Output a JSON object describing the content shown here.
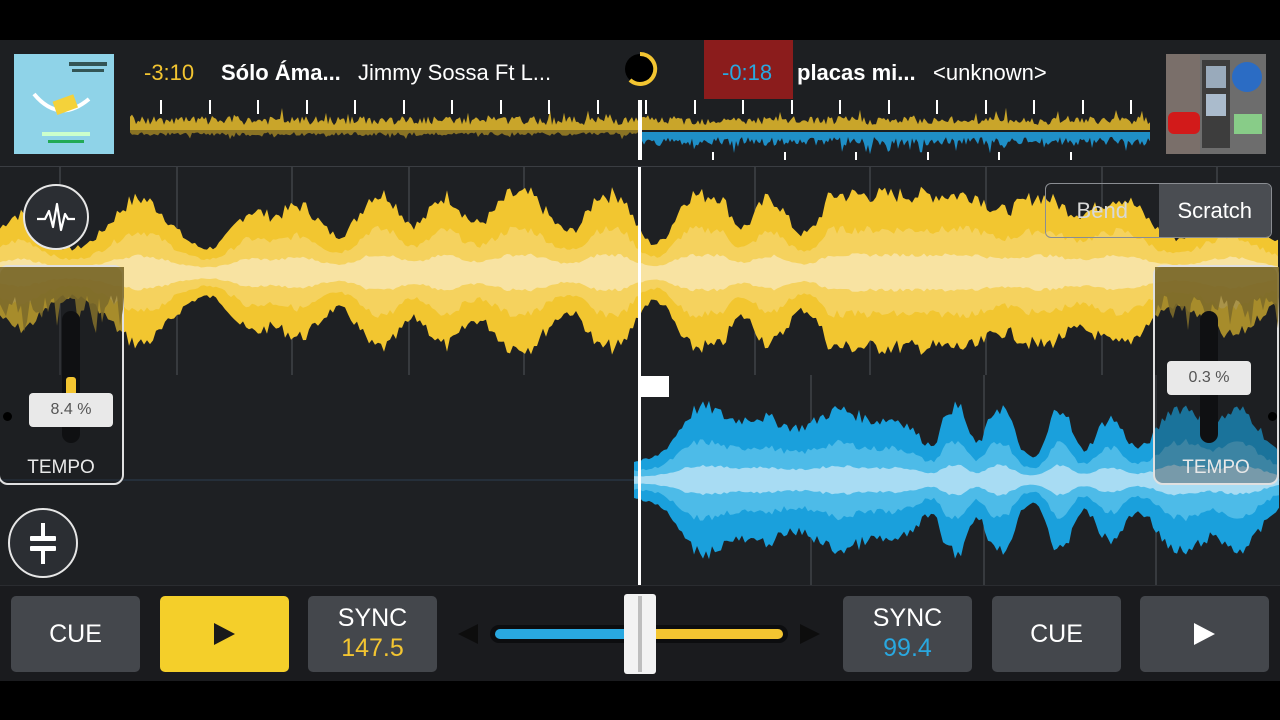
{
  "deckA": {
    "remaining_time": "-3:10",
    "title": "Sólo Áma...",
    "artist": "Jimmy Sossa Ft L...",
    "tempo_value": "8.4 %",
    "tempo_label": "TEMPO",
    "cue_label": "CUE",
    "sync_label": "SYNC",
    "bpm": "147.5",
    "color": "#f3c531"
  },
  "deckB": {
    "remaining_time": "-0:18",
    "title": "placas mi...",
    "artist": "<unknown>",
    "tempo_value": "0.3 %",
    "tempo_label": "TEMPO",
    "cue_label": "CUE",
    "sync_label": "SYNC",
    "bpm": "99.4",
    "color": "#29a8e0"
  },
  "mode_toggle": {
    "options": [
      "Bend",
      "Scratch"
    ],
    "active": "Scratch"
  },
  "crossfader": {
    "position": 0.5
  },
  "icons": {
    "waveform_toggle": "waveform-icon",
    "eq_toggle": "equalizer-icon",
    "play": "play-icon",
    "nudge_left": "arrow-left-icon",
    "nudge_right": "arrow-right-icon"
  }
}
